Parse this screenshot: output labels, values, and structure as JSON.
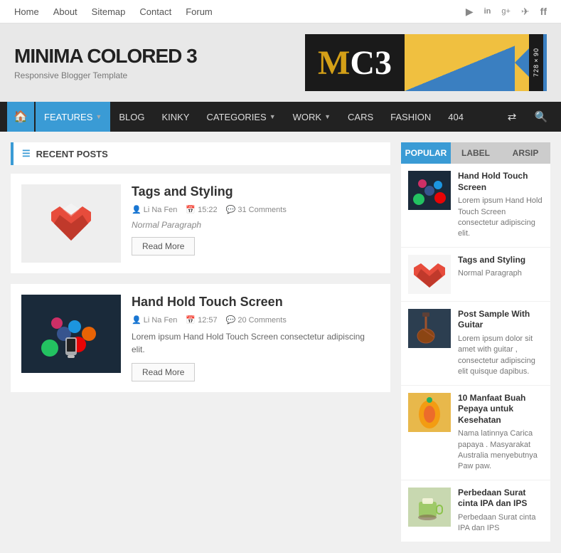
{
  "topNav": {
    "links": [
      "Home",
      "About",
      "Sitemap",
      "Contact",
      "Forum"
    ],
    "socialIcons": [
      "yt",
      "li",
      "gp",
      "tw",
      "fb"
    ]
  },
  "header": {
    "siteTitle": "MINIMA COLORED 3",
    "siteSubtitle": "Responsive Blogger Template",
    "logoM": "M",
    "logoC3": "C3",
    "bannerLabel": "728×90"
  },
  "mainNav": {
    "items": [
      {
        "label": "FEATURES",
        "hasArrow": true
      },
      {
        "label": "BLOG",
        "hasArrow": false
      },
      {
        "label": "KINKY",
        "hasArrow": false
      },
      {
        "label": "CATEGORIES",
        "hasArrow": true
      },
      {
        "label": "WORK",
        "hasArrow": true
      },
      {
        "label": "CARS",
        "hasArrow": false
      },
      {
        "label": "FASHION",
        "hasArrow": false
      },
      {
        "label": "404",
        "hasArrow": false
      }
    ]
  },
  "recentPosts": {
    "header": "Recent Posts",
    "posts": [
      {
        "id": "post1",
        "title": "Tags and Styling",
        "author": "Li Na Fen",
        "time": "15:22",
        "comments": "31 Comments",
        "paragraph": "Normal Paragraph",
        "excerpt": "",
        "readMore": "Read More",
        "thumbType": "heart"
      },
      {
        "id": "post2",
        "title": "Hand Hold Touch Screen",
        "author": "Li Na Fen",
        "time": "12:57",
        "comments": "20 Comments",
        "paragraph": "",
        "excerpt": "Lorem ipsum Hand Hold Touch Screen consectetur adipiscing elit.",
        "readMore": "Read More",
        "thumbType": "phone"
      }
    ]
  },
  "sidebar": {
    "tabs": [
      "Popular",
      "Label",
      "Arsip"
    ],
    "activeTab": "Popular",
    "items": [
      {
        "title": "Hand Hold Touch Screen",
        "excerpt": "Lorem ipsum Hand Hold Touch Screen consectetur adipiscing elit.",
        "thumbType": "colorful"
      },
      {
        "title": "Tags and Styling",
        "excerpt": "Normal Paragraph",
        "thumbType": "heart"
      },
      {
        "title": "Post Sample With Guitar",
        "excerpt": "Lorem ipsum dolor sit amet with guitar , consectetur adipiscing elit quisque dapibus.",
        "thumbType": "guitar"
      },
      {
        "title": "10 Manfaat Buah Pepaya untuk Kesehatan",
        "excerpt": "Nama latinnya Carica papaya . Masyarakat Australia menyebutnya Paw paw.",
        "thumbType": "papaya"
      },
      {
        "title": "Perbedaan Surat cinta IPA dan IPS",
        "excerpt": "Perbedaan Surat cinta IPA dan IPS",
        "thumbType": "tea"
      }
    ]
  }
}
